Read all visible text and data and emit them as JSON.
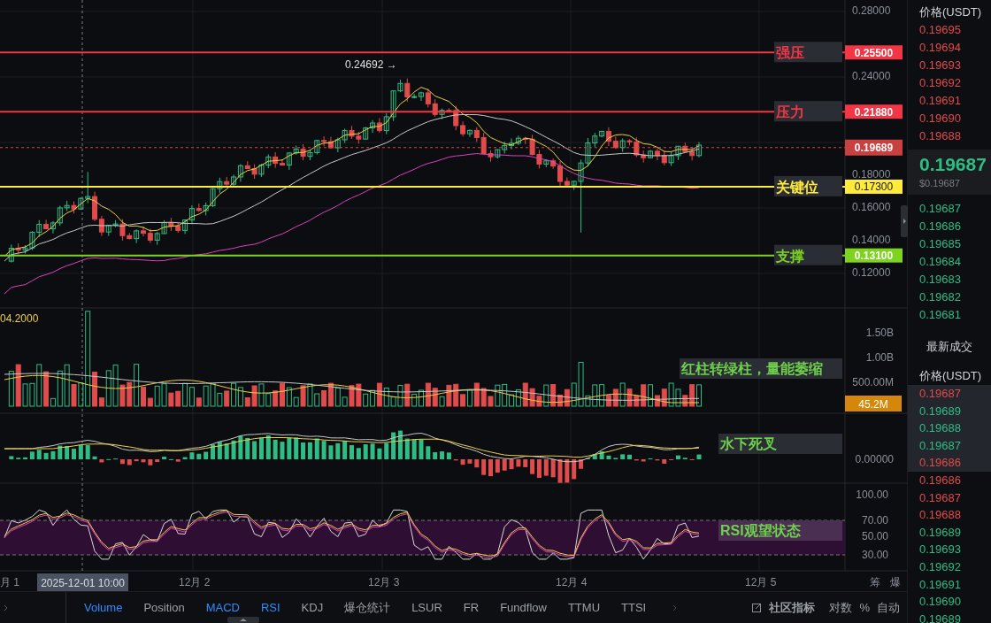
{
  "price_axis": {
    "ticks": [
      "0.28000",
      "0.24000",
      "0.18000",
      "0.16000",
      "0.14000",
      "0.12000"
    ]
  },
  "high_marker": "0.24692 →",
  "levels": [
    {
      "label": "强压",
      "price": "0.25500",
      "color": "#f23645"
    },
    {
      "label": "压力",
      "price": "0.21880",
      "color": "#f23645"
    },
    {
      "label": "关键位",
      "price": "0.17300",
      "color": "#ffeb3b"
    },
    {
      "label": "支撑",
      "price": "0.13100",
      "color": "#7ed321"
    }
  ],
  "last_price": "0.19689",
  "volume_panel": {
    "legend": "04.2000",
    "ticks": [
      "1.50B",
      "1.00B",
      "500.00M"
    ],
    "current": "45.2M",
    "note": "红柱转绿柱，量能萎缩"
  },
  "macd_panel": {
    "ticks": [
      "0.00000"
    ],
    "note": "水下死叉"
  },
  "rsi_panel": {
    "ticks": [
      "100.00",
      "70.00",
      "50.00",
      "30.00"
    ],
    "note": "RSI观望状态"
  },
  "time_axis": {
    "labels": [
      "月 1",
      "12月 2",
      "12月 3",
      "12月 4",
      "12月 5"
    ],
    "cursor": "2025-12-01 10:00",
    "buttons": [
      "筹",
      "爆"
    ]
  },
  "indicator_tabs": [
    {
      "label": "Volume",
      "selected": true
    },
    {
      "label": "Position",
      "selected": false
    },
    {
      "label": "MACD",
      "selected": true
    },
    {
      "label": "RSI",
      "selected": true
    },
    {
      "label": "KDJ",
      "selected": false
    },
    {
      "label": "爆仓统计",
      "selected": false
    },
    {
      "label": "LSUR",
      "selected": false
    },
    {
      "label": "FR",
      "selected": false
    },
    {
      "label": "Fundflow",
      "selected": false
    },
    {
      "label": "TTMU",
      "selected": false
    },
    {
      "label": "TTSI",
      "selected": false
    }
  ],
  "toolbar_right": {
    "community": "社区指标",
    "options": [
      "对数",
      "%",
      "自动"
    ]
  },
  "order_book": {
    "header": "价格(USDT)",
    "asks": [
      "0.19695",
      "0.19694",
      "0.19693",
      "0.19692",
      "0.19691",
      "0.19690",
      "0.19688"
    ],
    "last": "0.19687",
    "last_usd": "$0.19687",
    "bids": [
      "0.19687",
      "0.19686",
      "0.19685",
      "0.19684",
      "0.19683",
      "0.19682",
      "0.19681"
    ]
  },
  "trades": {
    "title": "最新成交",
    "header": "价格(USDT)",
    "rows": [
      {
        "price": "0.19687",
        "color": "#e04b4b",
        "highlighted": true
      },
      {
        "price": "0.19689",
        "color": "#2ebd85",
        "highlighted": true
      },
      {
        "price": "0.19688",
        "color": "#2ebd85",
        "highlighted": true
      },
      {
        "price": "0.19687",
        "color": "#2ebd85",
        "highlighted": true
      },
      {
        "price": "0.19686",
        "color": "#e04b4b",
        "highlighted": true
      },
      {
        "price": "0.19686",
        "color": "#e04b4b",
        "highlighted": false
      },
      {
        "price": "0.19687",
        "color": "#e04b4b",
        "highlighted": false
      },
      {
        "price": "0.19688",
        "color": "#e04b4b",
        "highlighted": false
      },
      {
        "price": "0.19689",
        "color": "#2ebd85",
        "highlighted": false
      },
      {
        "price": "0.19693",
        "color": "#2ebd85",
        "highlighted": false
      },
      {
        "price": "0.19692",
        "color": "#2ebd85",
        "highlighted": false
      },
      {
        "price": "0.19691",
        "color": "#2ebd85",
        "highlighted": false
      },
      {
        "price": "0.19690",
        "color": "#2ebd85",
        "highlighted": false
      },
      {
        "price": "0.19689",
        "color": "#2ebd85",
        "highlighted": false
      }
    ]
  }
}
